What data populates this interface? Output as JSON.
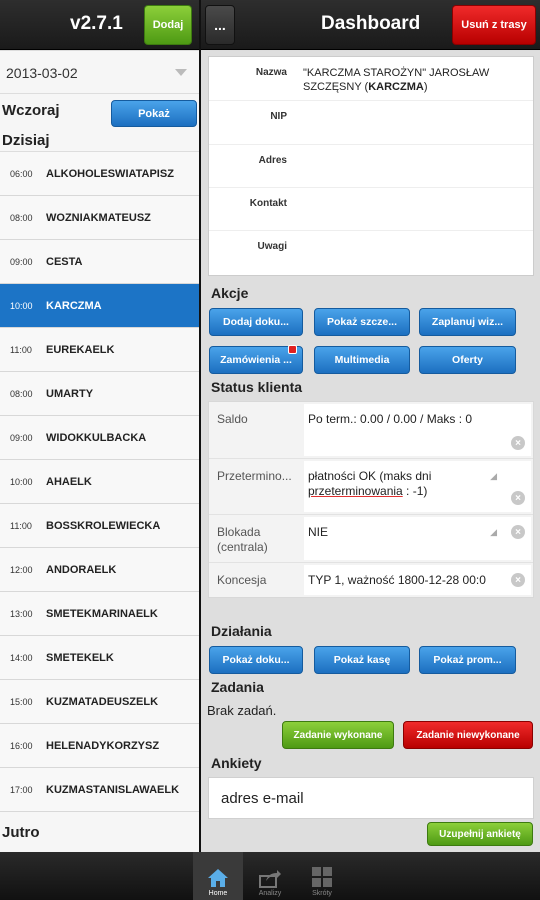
{
  "header": {
    "version": "v2.7.1",
    "add_label": "Dodaj",
    "menu_label": "...",
    "title": "Dashboard",
    "remove_label": "Usuń z trasy"
  },
  "sidebar": {
    "date": "2013-03-02",
    "yesterday_label": "Wczoraj",
    "show_label": "Pokaż",
    "today_label": "Dzisiaj",
    "tomorrow_label": "Jutro",
    "visits": [
      {
        "time": "06:00",
        "name": "ALKOHOLESWIATAPISZ"
      },
      {
        "time": "08:00",
        "name": "WOZNIAKMATEUSZ"
      },
      {
        "time": "09:00",
        "name": "CESTA"
      },
      {
        "time": "10:00",
        "name": "KARCZMA"
      },
      {
        "time": "11:00",
        "name": "EUREKAELK"
      },
      {
        "time": "08:00",
        "name": "UMARTY"
      },
      {
        "time": "09:00",
        "name": "WIDOKKULBACKA"
      },
      {
        "time": "10:00",
        "name": "AHAELK"
      },
      {
        "time": "11:00",
        "name": "BOSSKROLEWIECKA"
      },
      {
        "time": "12:00",
        "name": "ANDORAELK"
      },
      {
        "time": "13:00",
        "name": "SMETEKMARINAELK"
      },
      {
        "time": "14:00",
        "name": "SMETEKELK"
      },
      {
        "time": "15:00",
        "name": "KUZMATADEUSZELK"
      },
      {
        "time": "16:00",
        "name": "HELENADYKORZYSZ"
      },
      {
        "time": "17:00",
        "name": "KUZMASTANISLAWAELK"
      }
    ]
  },
  "client": {
    "name_label": "Nazwa",
    "name_value": "\"KARCZMA STAROŻYN\" JAROSŁAW SZCZĘSNY (",
    "name_bold": "KARCZMA",
    "name_tail": ")",
    "nip_label": "NIP",
    "address_label": "Adres",
    "contact_label": "Kontakt",
    "notes_label": "Uwagi"
  },
  "actions": {
    "title": "Akcje",
    "add_doc": "Dodaj doku...",
    "show_details": "Pokaż szcze...",
    "plan_visit": "Zaplanuj wiz...",
    "orders": "Zamówienia ...",
    "multimedia": "Multimedia",
    "offers": "Oferty"
  },
  "status": {
    "title": "Status klienta",
    "rows": [
      {
        "label": "Saldo",
        "value": "Po term.: 0.00 / 0.00 / Maks : 0"
      },
      {
        "label": "Przetermino...",
        "value_a": "płatności OK (maks dni ",
        "value_b": "przeterminowania",
        "value_c": " : -1)"
      },
      {
        "label": "Blokada (centrala)",
        "value": "NIE"
      },
      {
        "label": "Koncesja",
        "value": "TYP 1, ważność 1800-12-28 00:0"
      }
    ]
  },
  "operations": {
    "title": "Działania",
    "show_docs": "Pokaż doku...",
    "show_cash": "Pokaż kasę",
    "show_promo": "Pokaż prom..."
  },
  "tasks": {
    "title": "Zadania",
    "empty": "Brak zadań.",
    "done": "Zadanie wykonane",
    "not_done": "Zadanie niewykonane"
  },
  "surveys": {
    "title": "Ankiety",
    "item": "adres e-mail",
    "fill": "Uzupełnij ankietę"
  },
  "bottom_nav": {
    "home": "Home",
    "analyses": "Analizy",
    "other": "Skróty"
  },
  "colors": {
    "accent_blue": "#1c74c6",
    "green": "#5aa81e",
    "red": "#d10000"
  }
}
